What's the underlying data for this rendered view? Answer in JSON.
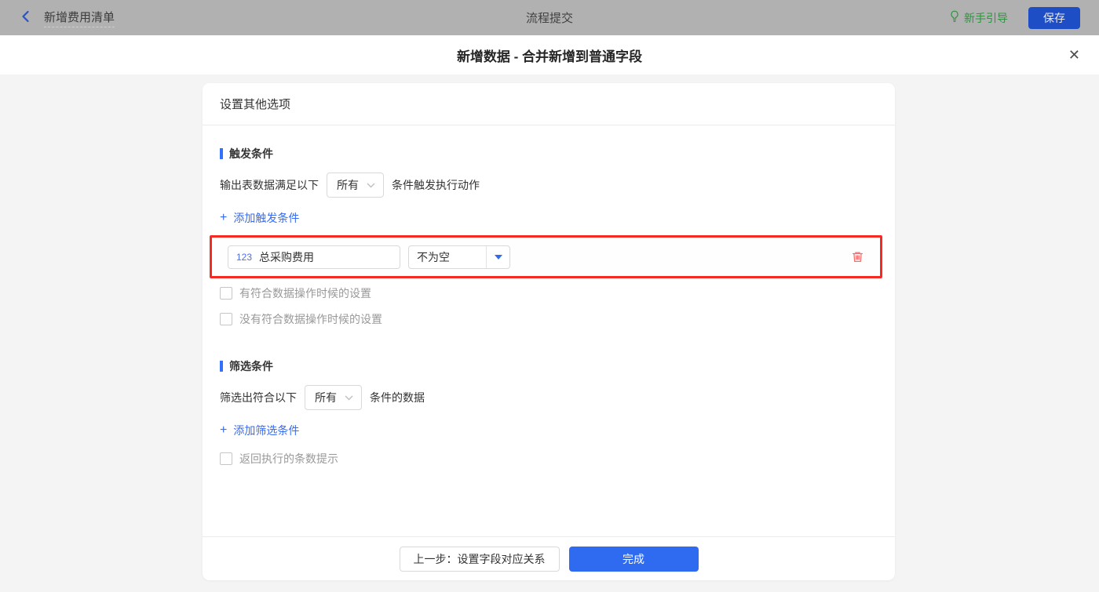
{
  "topbar": {
    "back_label": "新增费用清单",
    "title": "流程提交",
    "guide_label": "新手引导",
    "save_label": "保存"
  },
  "modal": {
    "title": "新增数据 - 合并新增到普通字段",
    "close_glyph": "✕"
  },
  "card": {
    "header": "设置其他选项",
    "trigger": {
      "section_title": "触发条件",
      "condition_prefix": "输出表数据满足以下",
      "condition_select_value": "所有",
      "condition_suffix": "条件触发执行动作",
      "add_plus": "+",
      "add_label": "添加触发条件",
      "rule": {
        "field_type_badge": "123",
        "field_name": "总采购费用",
        "operator_value": "不为空"
      },
      "checkboxes": [
        {
          "label": "有符合数据操作时候的设置",
          "checked": false
        },
        {
          "label": "没有符合数据操作时候的设置",
          "checked": false
        }
      ]
    },
    "filter": {
      "section_title": "筛选条件",
      "condition_prefix": "筛选出符合以下",
      "condition_select_value": "所有",
      "condition_suffix": "条件的数据",
      "add_plus": "+",
      "add_label": "添加筛选条件",
      "checkboxes": [
        {
          "label": "返回执行的条数提示",
          "checked": false
        }
      ]
    },
    "footer": {
      "prev_label": "上一步：设置字段对应关系",
      "done_label": "完成"
    }
  },
  "colors": {
    "accent_blue": "#3370ff",
    "dropdown_arrow_blue": "#2e6bf0",
    "save_button_blue": "#1d4ec6",
    "guide_green": "#2f9340",
    "highlight_border_red": "#f52a22",
    "trash_red": "#f56d6d",
    "topbar_dimmed_gray": "#b1b1b1",
    "body_background": "#f4f4f5"
  }
}
